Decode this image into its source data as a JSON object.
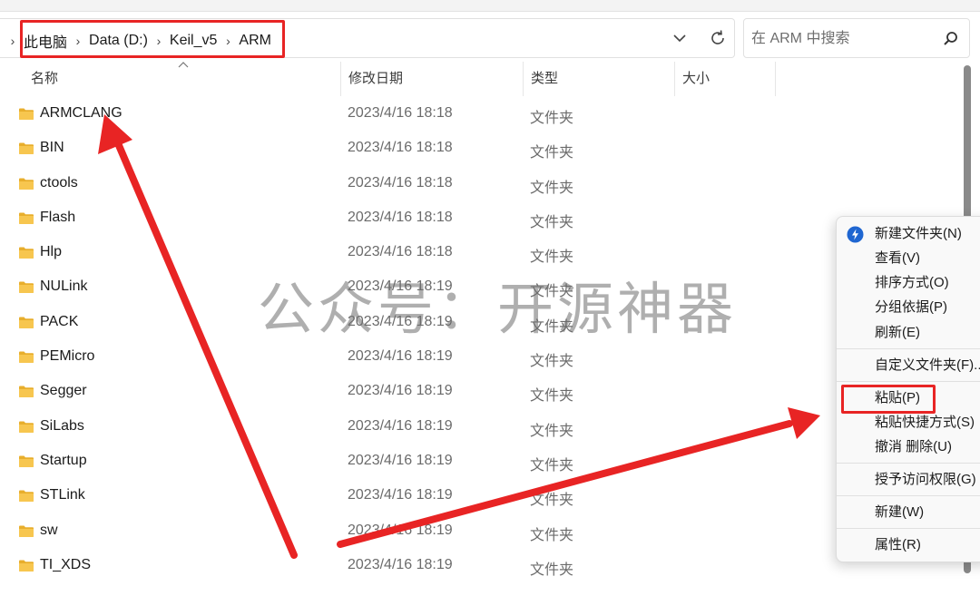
{
  "address_bar": {
    "crumbs": [
      "此电脑",
      "Data (D:)",
      "Keil_v5",
      "ARM"
    ]
  },
  "search": {
    "placeholder": "在 ARM 中搜索"
  },
  "columns": {
    "name": "名称",
    "modified": "修改日期",
    "type": "类型",
    "size": "大小"
  },
  "files": [
    {
      "name": "ARMCLANG",
      "modified": "2023/4/16 18:18",
      "type": "文件夹"
    },
    {
      "name": "BIN",
      "modified": "2023/4/16 18:18",
      "type": "文件夹"
    },
    {
      "name": "ctools",
      "modified": "2023/4/16 18:18",
      "type": "文件夹"
    },
    {
      "name": "Flash",
      "modified": "2023/4/16 18:18",
      "type": "文件夹"
    },
    {
      "name": "Hlp",
      "modified": "2023/4/16 18:18",
      "type": "文件夹"
    },
    {
      "name": "NULink",
      "modified": "2023/4/16 18:19",
      "type": "文件夹"
    },
    {
      "name": "PACK",
      "modified": "2023/4/16 18:19",
      "type": "文件夹"
    },
    {
      "name": "PEMicro",
      "modified": "2023/4/16 18:19",
      "type": "文件夹"
    },
    {
      "name": "Segger",
      "modified": "2023/4/16 18:19",
      "type": "文件夹"
    },
    {
      "name": "SiLabs",
      "modified": "2023/4/16 18:19",
      "type": "文件夹"
    },
    {
      "name": "Startup",
      "modified": "2023/4/16 18:19",
      "type": "文件夹"
    },
    {
      "name": "STLink",
      "modified": "2023/4/16 18:19",
      "type": "文件夹"
    },
    {
      "name": "sw",
      "modified": "2023/4/16 18:19",
      "type": "文件夹"
    },
    {
      "name": "TI_XDS",
      "modified": "2023/4/16 18:19",
      "type": "文件夹"
    }
  ],
  "context_menu": {
    "new_folder": "新建文件夹(N)",
    "view": "查看(V)",
    "sort_by": "排序方式(O)",
    "group_by": "分组依据(P)",
    "refresh": "刷新(E)",
    "customize": "自定义文件夹(F)...",
    "paste": "粘贴(P)",
    "paste_shortcut": "粘贴快捷方式(S)",
    "undo_delete": "撤消 删除(U)",
    "grant_access": "授予访问权限(G)",
    "new": "新建(W)",
    "properties": "属性(R)"
  },
  "watermark": "公众号：开源神器",
  "colors": {
    "annotation_red": "#e82424",
    "folder_yellow": "#f4c04a",
    "accent_blue": "#1f66d1"
  }
}
